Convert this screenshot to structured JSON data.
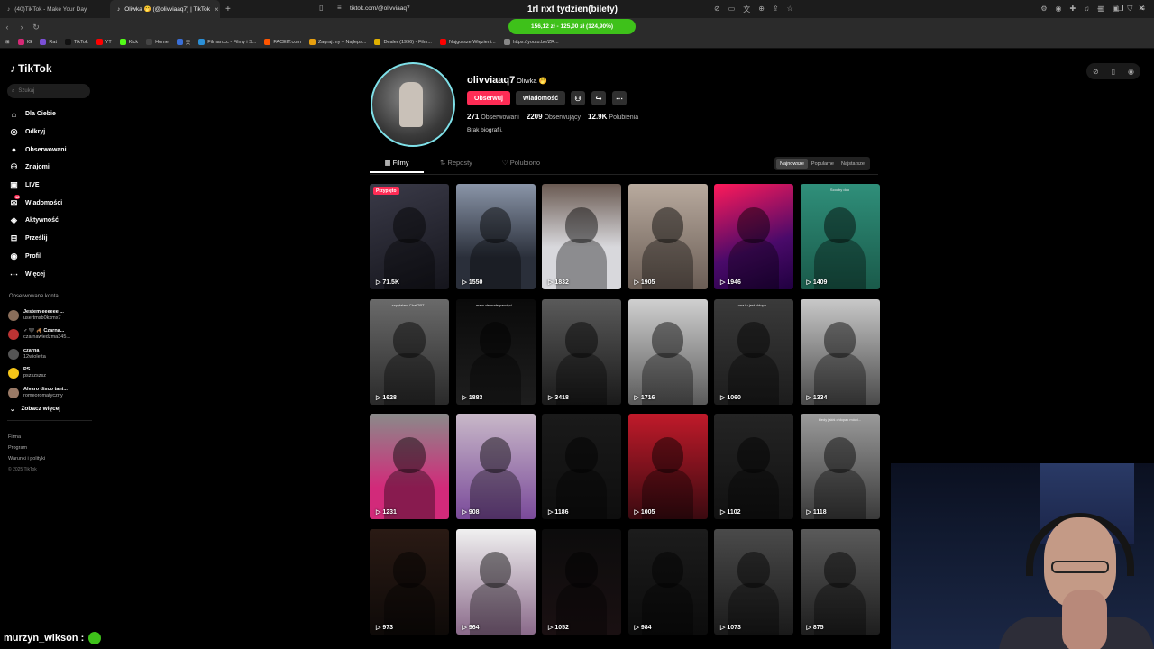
{
  "browser": {
    "tabs": [
      {
        "title": "(40)TikTok - Make Your Day",
        "active": false
      },
      {
        "title": "Oliwka 🤭 (@olivviaaq7) | TikTok",
        "active": true
      }
    ],
    "url": "tiktok.com/@olivviaaq7",
    "stream_title": "1rl nxt tydzien(bilety)",
    "donation_goal": "156,12 zł - 125,00 zł (124,90%)",
    "bookmarks": [
      {
        "label": "IG",
        "color": "#d62976"
      },
      {
        "label": "Rat",
        "color": "#7b4fd6"
      },
      {
        "label": "TikTok",
        "color": "#111111"
      },
      {
        "label": "YT",
        "color": "#ff0000"
      },
      {
        "label": "Kick",
        "color": "#53fc18"
      },
      {
        "label": "Home",
        "color": "#444444"
      },
      {
        "label": "天",
        "color": "#3a6fd8"
      },
      {
        "label": "Filman.cc - Filmy i S...",
        "color": "#2b8fd6"
      },
      {
        "label": "FACEIT.com",
        "color": "#ff5500"
      },
      {
        "label": "Zagraj.my – Najleps...",
        "color": "#e8a010"
      },
      {
        "label": "Dealer (1996) - Film...",
        "color": "#e0b000"
      },
      {
        "label": "Najgorsze Więzieni...",
        "color": "#ff0000"
      },
      {
        "label": "https://youtu.be/ZR...",
        "color": "#888888"
      }
    ]
  },
  "sidebar": {
    "logo": "TikTok",
    "search_placeholder": "Szukaj",
    "nav": [
      {
        "label": "Dla Ciebie",
        "icon": "home-icon"
      },
      {
        "label": "Odkryj",
        "icon": "compass-icon"
      },
      {
        "label": "Obserwowani",
        "icon": "following-avatar-icon"
      },
      {
        "label": "Znajomi",
        "icon": "friends-icon"
      },
      {
        "label": "LIVE",
        "icon": "live-icon"
      },
      {
        "label": "Wiadomości",
        "icon": "messages-icon",
        "badge": "18"
      },
      {
        "label": "Aktywność",
        "icon": "activity-icon"
      },
      {
        "label": "Prześlij",
        "icon": "upload-icon"
      },
      {
        "label": "Profil",
        "icon": "profile-icon"
      },
      {
        "label": "Więcej",
        "icon": "more-icon"
      }
    ],
    "following_title": "Obserwowane konta",
    "following": [
      {
        "name": "Jestem eeeeee ...",
        "handle": "usertmsb0kxmx7",
        "color": "#8a6e5a"
      },
      {
        "name": "♂ 🖤 🦂 Czarna...",
        "handle": "czarnawiedzma345...",
        "color": "#b33"
      },
      {
        "name": "czarna",
        "handle": "12wioletta",
        "color": "#555"
      },
      {
        "name": "PS",
        "handle": "pszszszsz",
        "color": "#f5c518"
      },
      {
        "name": "Alvaro disco tani...",
        "handle": "romeoromatyczny",
        "color": "#9a7a66"
      }
    ],
    "see_more": "Zobacz więcej",
    "footer": [
      "Firma",
      "Program",
      "Warunki i polityki"
    ],
    "copyright": "© 2025 TikTok"
  },
  "profile": {
    "username": "olivviaaq7",
    "display_name": "Oliwka 🤭",
    "follow_label": "Obserwuj",
    "message_label": "Wiadomość",
    "following_count": "271",
    "following_label": "Obserwowani",
    "followers_count": "2209",
    "followers_label": "Obserwujący",
    "likes_count": "12.9K",
    "likes_label": "Polubienia",
    "bio": "Brak biografii."
  },
  "tabs": [
    {
      "label": "Filmy",
      "icon": "grid-icon",
      "active": true
    },
    {
      "label": "Reposty",
      "icon": "repost-icon",
      "active": false
    },
    {
      "label": "Polubiono",
      "icon": "heart-icon",
      "active": false
    }
  ],
  "sort": [
    "Najnowsze",
    "Popularne",
    "Najstarsze"
  ],
  "videos": [
    {
      "views": "71.5K",
      "pinned": "Przypięto",
      "bg": "linear-gradient(160deg,#3a3a48,#15151c)"
    },
    {
      "views": "1550",
      "bg": "linear-gradient(180deg,#8a95a8,#2a2f3a 70%)"
    },
    {
      "views": "1832",
      "bg": "linear-gradient(180deg,#6a5a52,#d8d8dc 60%)"
    },
    {
      "views": "1905",
      "bg": "linear-gradient(180deg,#b8aa9e,#6a5d55)"
    },
    {
      "views": "1946",
      "bg": "linear-gradient(160deg,#ff1a5a,#4a0a6a 60%,#200040)"
    },
    {
      "views": "1409",
      "bg": "linear-gradient(180deg,#2f8f7a,#1a5a4a)",
      "caption": "Scooby doo"
    },
    {
      "views": "1628",
      "bg": "linear-gradient(180deg,#6a6a6a,#2a2a2a)",
      "caption": "zapytałam ChatGPT..."
    },
    {
      "views": "1883",
      "bg": "linear-gradient(180deg,#0a0a0a,#1e1e1e)",
      "caption": "mam złe małe pamięci..."
    },
    {
      "views": "3418",
      "bg": "linear-gradient(180deg,#5a5a5a,#1a1a1a)"
    },
    {
      "views": "1716",
      "bg": "linear-gradient(180deg,#d0d0d0,#5a5a5a)"
    },
    {
      "views": "1060",
      "bg": "linear-gradient(180deg,#3a3a3a,#1c1c1c)",
      "caption": "ona tu jest chłopu..."
    },
    {
      "views": "1334",
      "bg": "linear-gradient(180deg,#c8c8c8,#4a4a4a)"
    },
    {
      "views": "1231",
      "bg": "linear-gradient(180deg,#8a8a8a,#d22a7a 70%)"
    },
    {
      "views": "908",
      "bg": "linear-gradient(180deg,#c8b8c8,#7a4a9a)"
    },
    {
      "views": "1186",
      "bg": "linear-gradient(180deg,#1a1a1a,#0e0e0e)"
    },
    {
      "views": "1005",
      "bg": "linear-gradient(180deg,#c01a2a,#3a0a10)"
    },
    {
      "views": "1102",
      "bg": "linear-gradient(180deg,#242424,#111111)"
    },
    {
      "views": "1118",
      "bg": "linear-gradient(180deg,#9a9a9a,#3a3a3a)",
      "caption": "kiedy jakiś chłopak mówi..."
    },
    {
      "views": "973",
      "bg": "linear-gradient(180deg,#2a1a14,#0e0a08)"
    },
    {
      "views": "964",
      "bg": "linear-gradient(180deg,#f0f0f0,#8a6a8a)"
    },
    {
      "views": "1052",
      "bg": "linear-gradient(180deg,#0c0c0c,#1a1012)"
    },
    {
      "views": "984",
      "bg": "linear-gradient(180deg,#1c1c1c,#0c0c0c)"
    },
    {
      "views": "1073",
      "bg": "linear-gradient(180deg,#4a4a4a,#1a1a1a)"
    },
    {
      "views": "875",
      "bg": "linear-gradient(180deg,#5a5a5a,#1e1e1e)"
    }
  ],
  "chat": {
    "user": "murzyn_wikson :"
  }
}
